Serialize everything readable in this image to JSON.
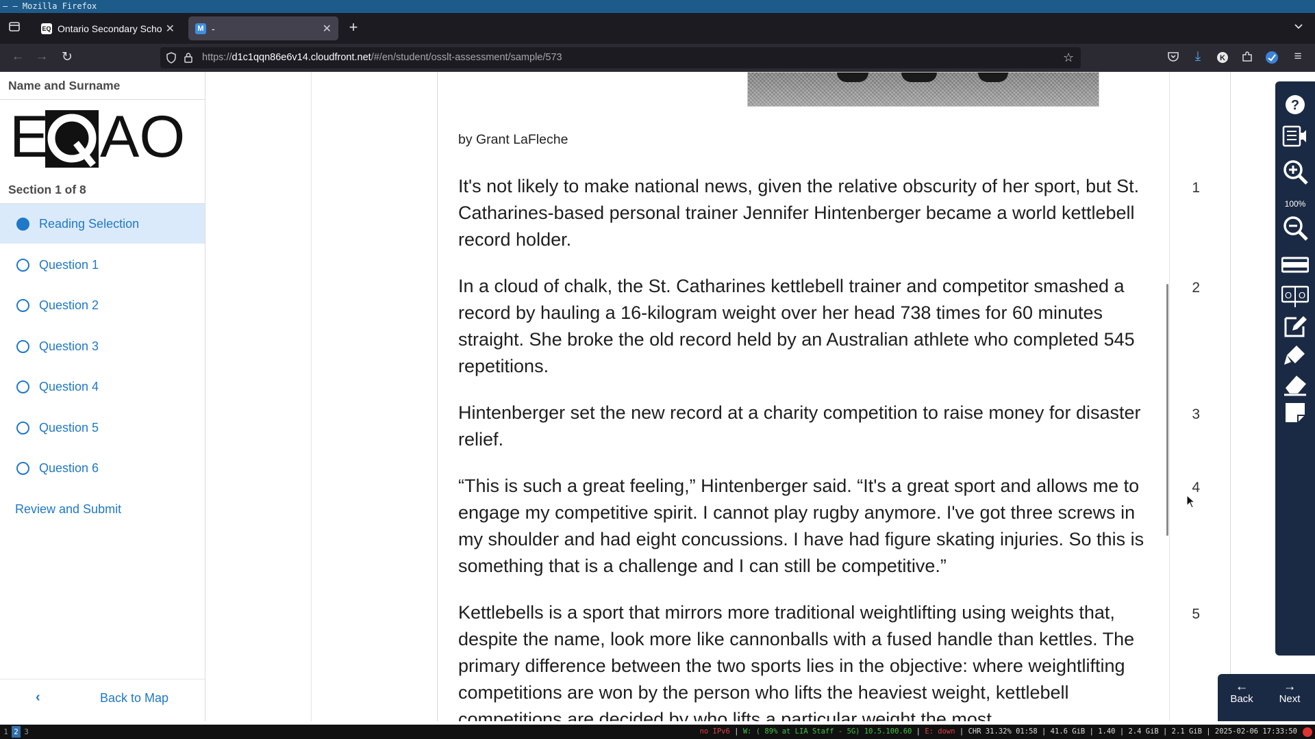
{
  "window": {
    "title": "– – Mozilla Firefox"
  },
  "browser": {
    "tabs": [
      {
        "title": "Ontario Secondary School",
        "favicon": "eqao-favicon",
        "active": false
      },
      {
        "title": "-",
        "favicon": "m-favicon",
        "active": true
      }
    ],
    "url_base": "https://",
    "url_host": "d1c1qqn86e6v14.cloudfront.net",
    "url_path": "/#/en/student/osslt-assessment/sample/573"
  },
  "sidebar": {
    "name_label": "Name and Surname",
    "logo_text": "EQAO",
    "section_label": "Section 1 of 8",
    "items": [
      {
        "label": "Reading Selection",
        "active": true
      },
      {
        "label": "Question 1",
        "active": false
      },
      {
        "label": "Question 2",
        "active": false
      },
      {
        "label": "Question 3",
        "active": false
      },
      {
        "label": "Question 4",
        "active": false
      },
      {
        "label": "Question 5",
        "active": false
      },
      {
        "label": "Question 6",
        "active": false
      }
    ],
    "review_label": "Review and Submit",
    "back_to_map_label": "Back to Map"
  },
  "reading": {
    "byline": "by Grant LaFleche",
    "paragraphs": [
      {
        "num": "1",
        "text": "It's not likely to make national news, given the relative obscurity of her sport, but St. Catharines-based personal trainer Jennifer Hintenberger became a world kettlebell record holder."
      },
      {
        "num": "2",
        "text": "In a cloud of chalk, the St. Catharines kettlebell trainer and competitor smashed a record by hauling a 16-kilogram weight over her head 738 times for 60 minutes straight. She broke the old record held by an Australian athlete who completed 545 repetitions."
      },
      {
        "num": "3",
        "text": "Hintenberger set the new record at a charity competition to raise money for disaster relief."
      },
      {
        "num": "4",
        "text": "“This is such a great feeling,” Hintenberger said. “It's a great sport and allows me to engage my competitive spirit. I cannot play rugby anymore. I've got three screws in my shoulder and had eight concussions. I have had figure skating injuries. So this is something that is a challenge and I can still be competitive.”"
      },
      {
        "num": "5",
        "text": "Kettlebells is a sport that mirrors more traditional weightlifting using weights that, despite the name, look more like cannonballs with a fused handle than kettles. The primary difference between the two sports lies in the objective: where weightlifting competitions are won by the person who lifts the heaviest weight, kettlebell competitions are decided by who lifts a particular weight the most"
      }
    ]
  },
  "toolbar": {
    "zoom_level": "100%",
    "tools": [
      "help-icon",
      "text-to-speech-icon",
      "zoom-in-icon",
      "zoom-out-icon",
      "line-reader-icon",
      "hide-options-icon",
      "notepad-icon",
      "highlighter-icon",
      "eraser-icon",
      "sticky-note-icon"
    ]
  },
  "navigation": {
    "back_label": "Back",
    "next_label": "Next"
  },
  "statusbar": {
    "workspaces": [
      "1",
      "2",
      "3"
    ],
    "current_workspace": "2",
    "ipv6": "no IPv6",
    "wifi": "W: ( 89% at LIA Staff - 5G) 10.5.100.60",
    "ethernet": "E: down",
    "stats": "CHR 31.32% 01:58 | 41.6 GiB | 1.40 | 2.4 GiB | 2.1 GiB | 2025-02-06 17:33:50"
  },
  "colors": {
    "accent": "#1f78c8",
    "active_item_bg": "#dbeafb",
    "toolbar_bg": "#1b2a44"
  }
}
